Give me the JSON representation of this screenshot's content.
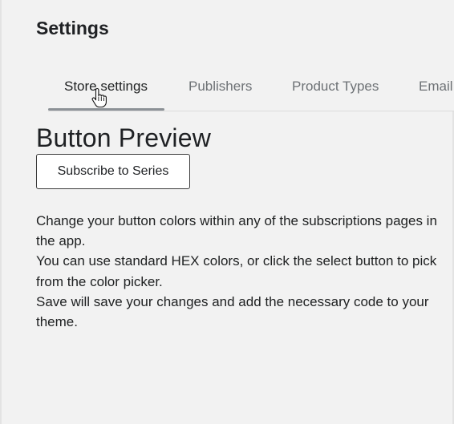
{
  "page": {
    "title": "Settings"
  },
  "tabs": [
    {
      "label": "Store settings",
      "active": true
    },
    {
      "label": "Publishers",
      "active": false
    },
    {
      "label": "Product Types",
      "active": false
    },
    {
      "label": "Email",
      "active": false
    }
  ],
  "preview": {
    "title": "Button Preview",
    "button_label": "Subscribe to Series"
  },
  "help": {
    "lines": [
      "Change your button colors within any of the subscriptions pages in the app.",
      "You can use standard HEX colors, or click the select button to pick from the color picker.",
      "Save will save your changes and add the necessary code to your theme."
    ]
  },
  "cursor": {
    "icon": "hand-pointer-icon"
  }
}
